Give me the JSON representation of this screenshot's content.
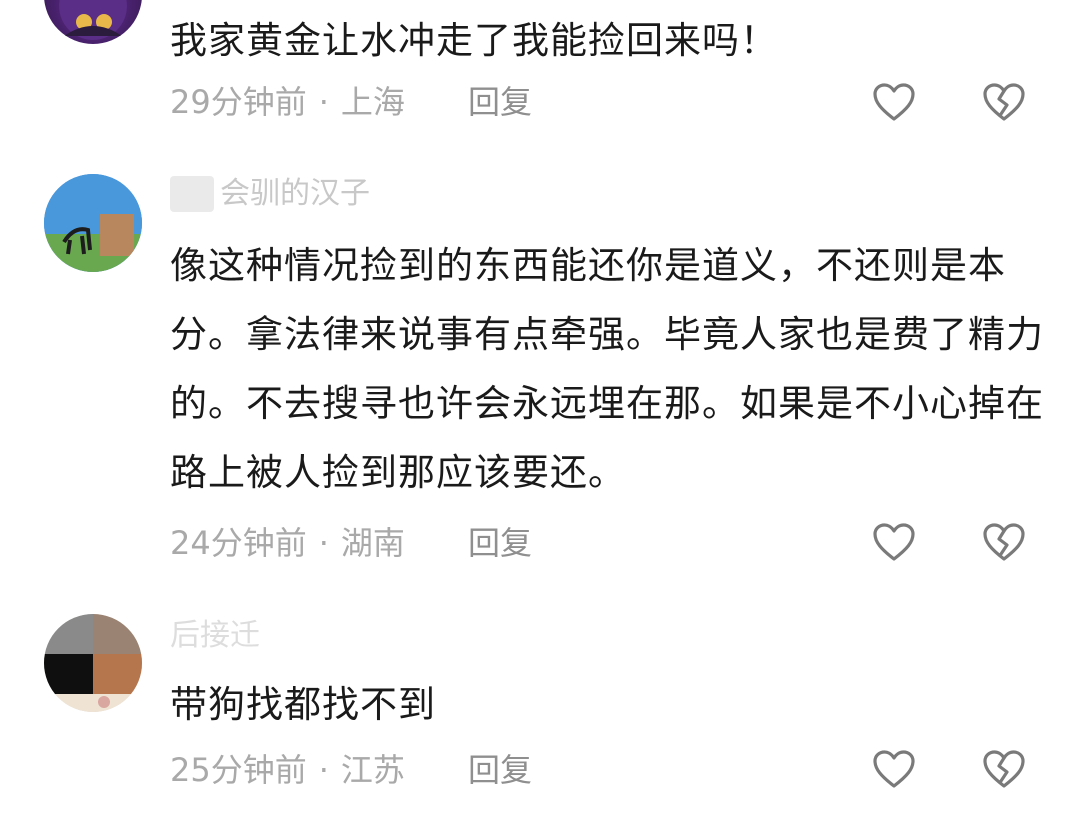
{
  "comments": [
    {
      "username": "",
      "text": "我家黄金让水冲走了我能捡回来吗！",
      "time": "29分钟前",
      "separator": "·",
      "location": "上海",
      "reply_label": "回复",
      "like_icon": "heart-icon",
      "dislike_icon": "broken-heart-icon"
    },
    {
      "username": "会驯的汉子",
      "text": "像这种情况捡到的东西能还你是道义，不还则是本分。拿法律来说事有点牵强。毕竟人家也是费了精力的。不去搜寻也许会永远埋在那。如果是不小心掉在路上被人捡到那应该要还。",
      "time": "24分钟前",
      "separator": "·",
      "location": "湖南",
      "reply_label": "回复",
      "like_icon": "heart-icon",
      "dislike_icon": "broken-heart-icon"
    },
    {
      "username": "后接迁",
      "text": "带狗找都找不到",
      "time": "25分钟前",
      "separator": "·",
      "location": "江苏",
      "reply_label": "回复",
      "like_icon": "heart-icon",
      "dislike_icon": "broken-heart-icon"
    }
  ],
  "colors": {
    "text": "#1a1a1a",
    "meta": "#a9a9a9",
    "icon": "#7a7a7a",
    "background": "#ffffff"
  }
}
